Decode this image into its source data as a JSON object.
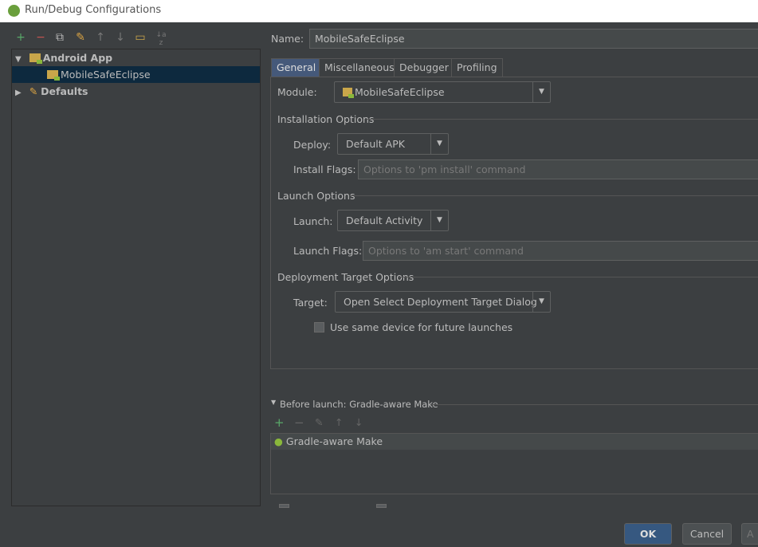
{
  "window": {
    "title": "Run/Debug Configurations"
  },
  "toolbar": {
    "add": "+",
    "remove": "−",
    "copy": "⧉",
    "edit_defaults": "✎",
    "up": "↑",
    "down": "↓",
    "folder": "▭",
    "sort": "↓a z"
  },
  "tree": [
    {
      "label": "Android App",
      "expanded": true
    },
    {
      "label": "MobileSafeEclipse",
      "selected": true
    },
    {
      "label": "Defaults",
      "expanded": false
    }
  ],
  "name": {
    "label": "Name:",
    "value": "MobileSafeEclipse"
  },
  "tabs": [
    {
      "label": "General",
      "active": true
    },
    {
      "label": "Miscellaneous"
    },
    {
      "label": "Debugger"
    },
    {
      "label": "Profiling"
    }
  ],
  "module": {
    "label": "Module:",
    "value": "MobileSafeEclipse"
  },
  "installation": {
    "title": "Installation Options",
    "deploy_label": "Deploy:",
    "deploy_value": "Default APK",
    "flags_label": "Install Flags:",
    "flags_placeholder": "Options to 'pm install' command"
  },
  "launch": {
    "title": "Launch Options",
    "launch_label": "Launch:",
    "launch_value": "Default Activity",
    "flags_label": "Launch Flags:",
    "flags_placeholder": "Options to 'am start' command"
  },
  "deployment": {
    "title": "Deployment Target Options",
    "target_label": "Target:",
    "target_value": "Open Select Deployment Target Dialog",
    "same_device_label": "Use same device for future launches",
    "same_device_checked": false
  },
  "before_launch": {
    "title": "Before launch: Gradle-aware Make",
    "items": [
      "Gradle-aware Make"
    ]
  },
  "buttons": {
    "ok": "OK",
    "cancel": "Cancel",
    "apply": "A"
  },
  "colors": {
    "background": "#3c3f41",
    "selection": "#0d293e",
    "active_tab": "#45597a",
    "ok_button": "#365880",
    "add_green": "#59a869",
    "remove_red": "#c75450"
  }
}
